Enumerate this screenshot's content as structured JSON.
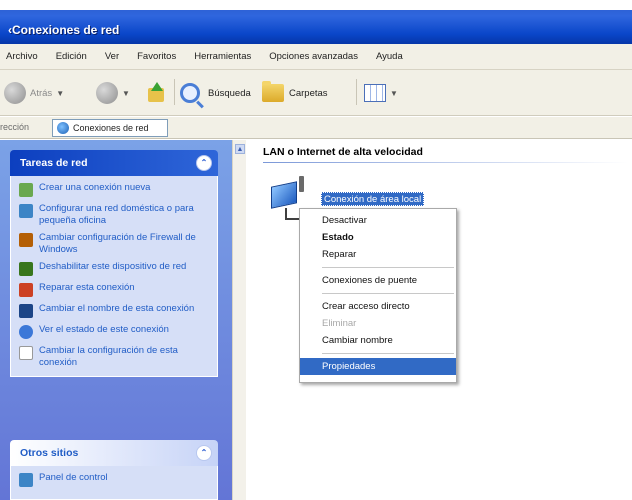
{
  "window": {
    "title": "Conexiones de red"
  },
  "menu": [
    "Archivo",
    "Edición",
    "Ver",
    "Favoritos",
    "Herramientas",
    "Opciones avanzadas",
    "Ayuda"
  ],
  "toolbar": {
    "back_label": "Atrás",
    "search_label": "Búsqueda",
    "folders_label": "Carpetas"
  },
  "address": {
    "label": "rección",
    "value": "Conexiones de red"
  },
  "sidebar": {
    "network_tasks": {
      "title": "Tareas de red",
      "items": [
        {
          "label": "Crear una conexión nueva",
          "icon": "new-connection-icon",
          "color": "#6aa84f"
        },
        {
          "label": "Configurar una red doméstica o para pequeña oficina",
          "icon": "home-network-icon",
          "color": "#3d85c6"
        },
        {
          "label": "Cambiar configuración de Firewall de Windows",
          "icon": "firewall-icon",
          "color": "#b45f06"
        },
        {
          "label": "Deshabilitar este dispositivo de red",
          "icon": "disable-device-icon",
          "color": "#38761d"
        },
        {
          "label": "Reparar esta conexión",
          "icon": "repair-icon",
          "color": "#cc4125"
        },
        {
          "label": "Cambiar el nombre de esta conexión",
          "icon": "rename-icon",
          "color": "#1c4587"
        },
        {
          "label": "Ver el estado de este conexión",
          "icon": "status-icon",
          "color": "#3c78d8"
        },
        {
          "label": "Cambiar la configuración de esta conexión",
          "icon": "settings-page-icon",
          "color": "#999999"
        }
      ]
    },
    "other_places": {
      "title": "Otros sitios",
      "items": [
        {
          "label": "Panel de control",
          "icon": "control-panel-icon",
          "color": "#3d85c6"
        }
      ]
    }
  },
  "content": {
    "group_header": "LAN o Internet de alta velocidad",
    "connection_name": "Conexión de área local"
  },
  "context_menu": {
    "items": [
      {
        "label": "Desactivar",
        "style": "normal"
      },
      {
        "label": "Estado",
        "style": "bold"
      },
      {
        "label": "Reparar",
        "style": "normal"
      },
      {
        "sep": true
      },
      {
        "label": "Conexiones de puente",
        "style": "normal"
      },
      {
        "sep": true
      },
      {
        "label": "Crear acceso directo",
        "style": "normal"
      },
      {
        "label": "Eliminar",
        "style": "disabled"
      },
      {
        "label": "Cambiar nombre",
        "style": "normal"
      },
      {
        "sep": true
      },
      {
        "label": "Propiedades",
        "style": "selected"
      }
    ]
  }
}
